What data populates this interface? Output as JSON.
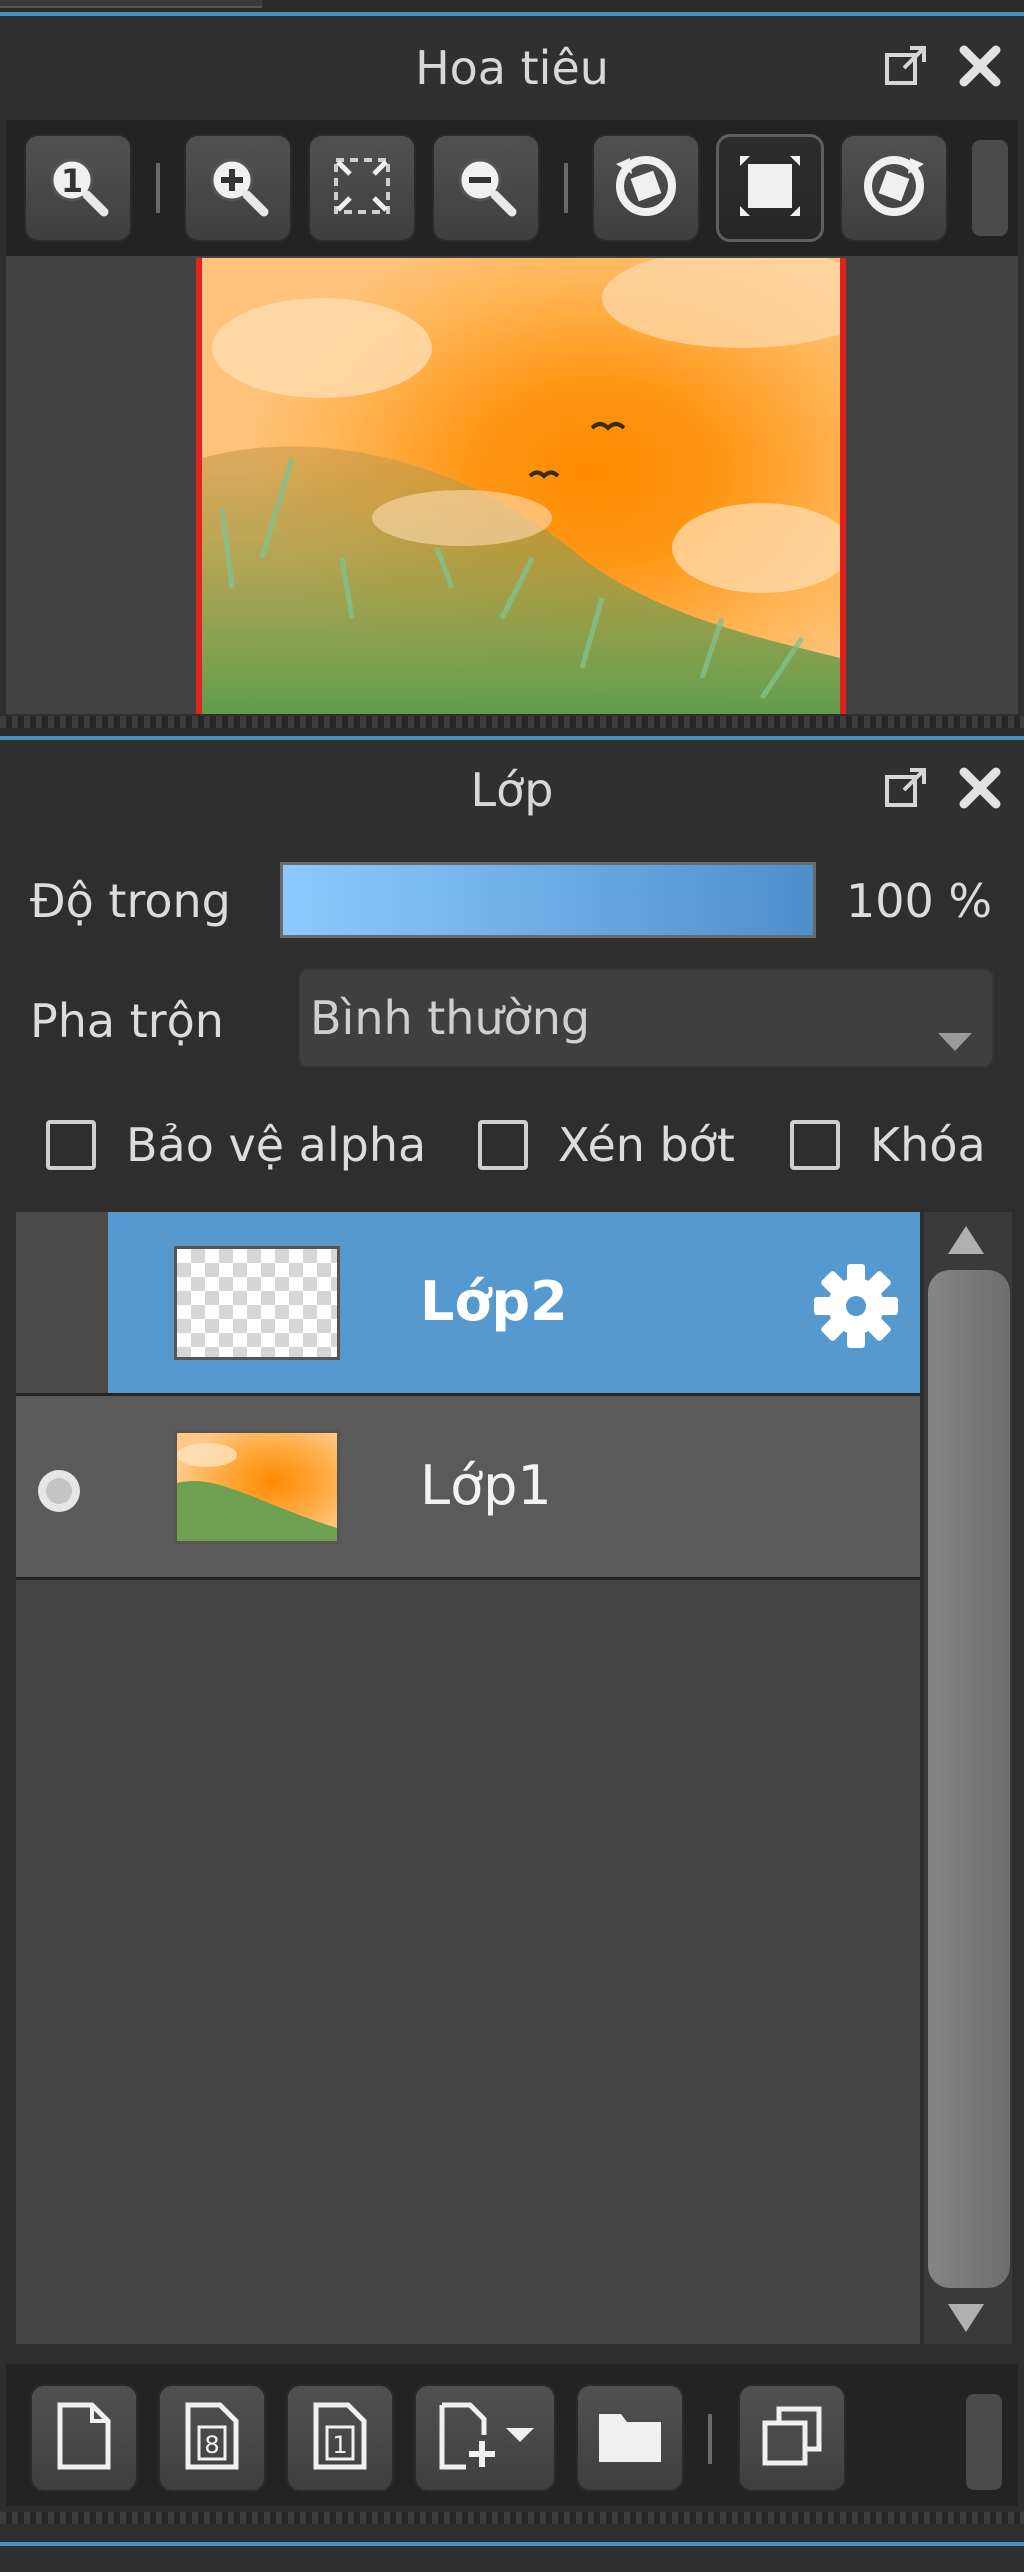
{
  "navigator": {
    "title": "Hoa tiêu",
    "tools": [
      {
        "icon": "zoom-actual-size-icon"
      },
      {
        "icon": "zoom-in-icon"
      },
      {
        "icon": "fit-to-screen-icon"
      },
      {
        "icon": "zoom-out-icon"
      },
      {
        "icon": "rotate-left-icon"
      },
      {
        "icon": "fit-canvas-icon",
        "active": true
      },
      {
        "icon": "rotate-right-icon"
      }
    ]
  },
  "layers": {
    "title": "Lớp",
    "opacity_label": "Độ trong",
    "opacity_value": "100 %",
    "opacity": 1.0,
    "blend_label": "Pha trộn",
    "blend_value": "Bình thường",
    "checkboxes": {
      "alpha_protect": "Bảo vệ alpha",
      "clipping": "Xén bớt",
      "lock": "Khóa"
    },
    "items": [
      {
        "name": "Lớp2",
        "selected": true,
        "visible": false
      },
      {
        "name": "Lớp1",
        "selected": false,
        "visible": true
      }
    ]
  },
  "colors": {
    "accent": "#4a8fc4",
    "selected_row": "#5599cf",
    "preview_border": "#e0231d"
  }
}
